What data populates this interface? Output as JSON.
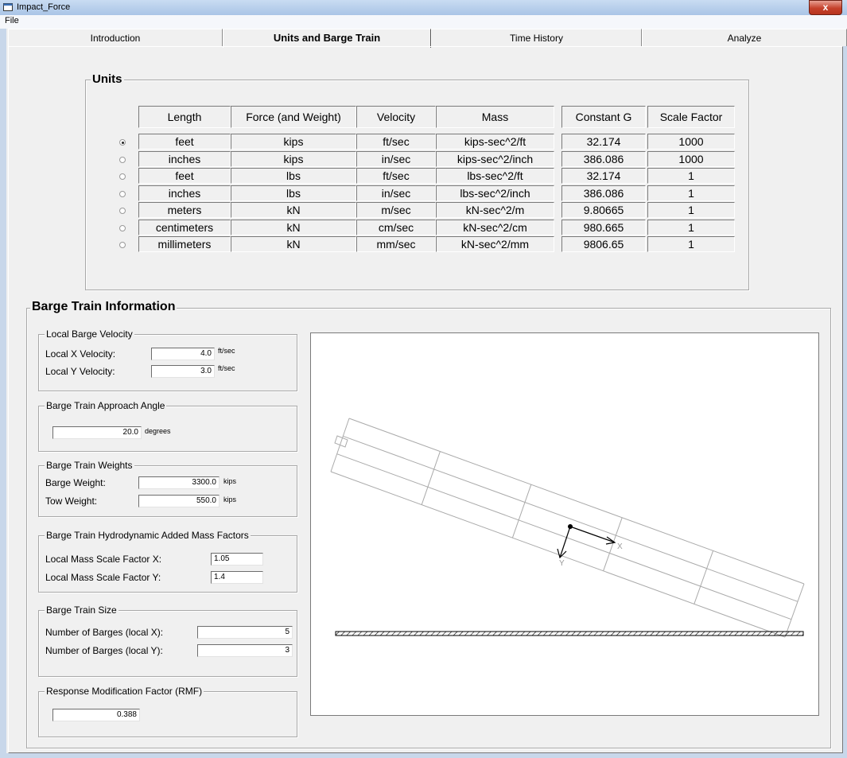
{
  "window": {
    "title": "Impact_Force",
    "close_glyph": "x"
  },
  "menu": {
    "file": "File"
  },
  "tabs": [
    {
      "label": "Introduction"
    },
    {
      "label": "Units and Barge Train"
    },
    {
      "label": "Time History"
    },
    {
      "label": "Analyze"
    }
  ],
  "units": {
    "title": "Units",
    "headers": [
      "Length",
      "Force (and Weight)",
      "Velocity",
      "Mass",
      "Constant G",
      "Scale Factor"
    ],
    "rows": [
      {
        "length": "feet",
        "force": "kips",
        "velocity": "ft/sec",
        "mass": "kips-sec^2/ft",
        "g": "32.174",
        "scale": "1000",
        "selected": true
      },
      {
        "length": "inches",
        "force": "kips",
        "velocity": "in/sec",
        "mass": "kips-sec^2/inch",
        "g": "386.086",
        "scale": "1000",
        "selected": false
      },
      {
        "length": "feet",
        "force": "lbs",
        "velocity": "ft/sec",
        "mass": "lbs-sec^2/ft",
        "g": "32.174",
        "scale": "1",
        "selected": false
      },
      {
        "length": "inches",
        "force": "lbs",
        "velocity": "in/sec",
        "mass": "lbs-sec^2/inch",
        "g": "386.086",
        "scale": "1",
        "selected": false
      },
      {
        "length": "meters",
        "force": "kN",
        "velocity": "m/sec",
        "mass": "kN-sec^2/m",
        "g": "9.80665",
        "scale": "1",
        "selected": false
      },
      {
        "length": "centimeters",
        "force": "kN",
        "velocity": "cm/sec",
        "mass": "kN-sec^2/cm",
        "g": "980.665",
        "scale": "1",
        "selected": false
      },
      {
        "length": "millimeters",
        "force": "kN",
        "velocity": "mm/sec",
        "mass": "kN-sec^2/mm",
        "g": "9806.65",
        "scale": "1",
        "selected": false
      }
    ]
  },
  "barge": {
    "title": "Barge Train Information",
    "velocity": {
      "title": "Local Barge Velocity",
      "x_label": "Local X Velocity:",
      "x_value": "4.0",
      "x_unit": "ft/sec",
      "y_label": "Local Y Velocity:",
      "y_value": "3.0",
      "y_unit": "ft/sec"
    },
    "angle": {
      "title": "Barge Train Approach Angle",
      "value": "20.0",
      "unit": "degrees"
    },
    "weights": {
      "title": "Barge Train Weights",
      "barge_label": "Barge Weight:",
      "barge_value": "3300.0",
      "barge_unit": "kips",
      "tow_label": "Tow Weight:",
      "tow_value": "550.0",
      "tow_unit": "kips"
    },
    "mass_factors": {
      "title": "Barge Train Hydrodynamic Added Mass Factors",
      "x_label": "Local Mass Scale Factor X:",
      "x_value": "1.05",
      "y_label": "Local Mass Scale Factor Y:",
      "y_value": "1.4"
    },
    "size": {
      "title": "Barge Train Size",
      "x_label": "Number of Barges (local X):",
      "x_value": "5",
      "y_label": "Number of Barges (local Y):",
      "y_value": "3"
    },
    "rmf": {
      "title": "Response Modification Factor (RMF)",
      "value": "0.388"
    },
    "diagram": {
      "x_axis_label": "X",
      "y_axis_label": "Y"
    }
  }
}
